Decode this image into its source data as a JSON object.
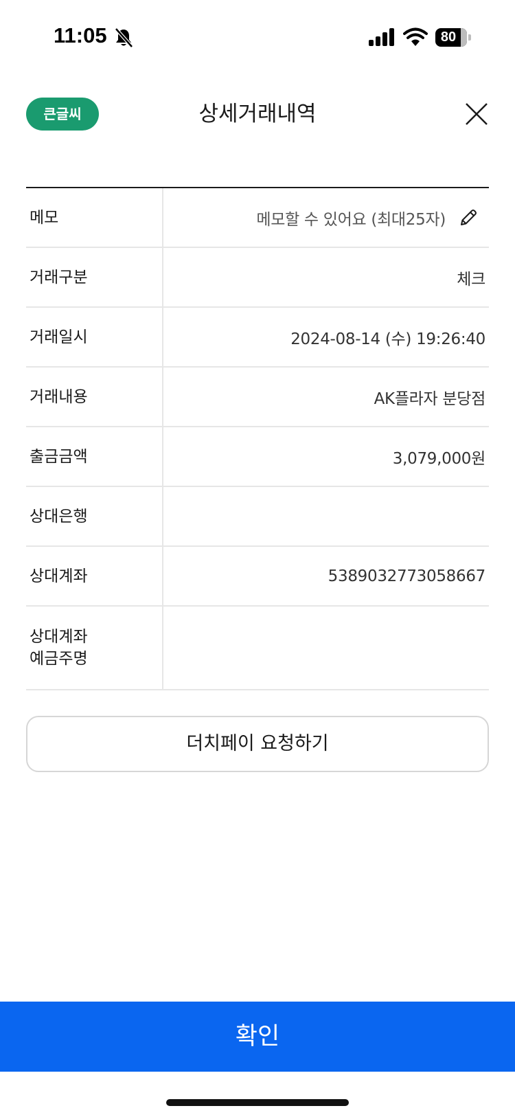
{
  "status_bar": {
    "time": "11:05",
    "battery_level": "80",
    "battery_fraction": 0.8
  },
  "header": {
    "large_font_label": "큰글씨",
    "title": "상세거래내역"
  },
  "details": {
    "memo": {
      "label": "메모",
      "placeholder": "메모할 수 있어요 (최대25자)"
    },
    "transaction_type": {
      "label": "거래구분",
      "value": "체크"
    },
    "transaction_datetime": {
      "label": "거래일시",
      "value": "2024-08-14 (수) 19:26:40"
    },
    "transaction_description": {
      "label": "거래내용",
      "value": "AK플라자 분당점"
    },
    "withdrawal_amount": {
      "label": "출금금액",
      "value": "3,079,000원"
    },
    "counterparty_bank": {
      "label": "상대은행",
      "value": ""
    },
    "counterparty_account": {
      "label": "상대계좌",
      "value": "5389032773058667"
    },
    "counterparty_holder": {
      "label": "상대계좌\n예금주명",
      "value": ""
    }
  },
  "actions": {
    "dutch_pay_label": "더치페이 요청하기",
    "confirm_label": "확인"
  },
  "colors": {
    "large_font_badge": "#1a9b6f",
    "confirm_bar": "#0a66f0"
  }
}
